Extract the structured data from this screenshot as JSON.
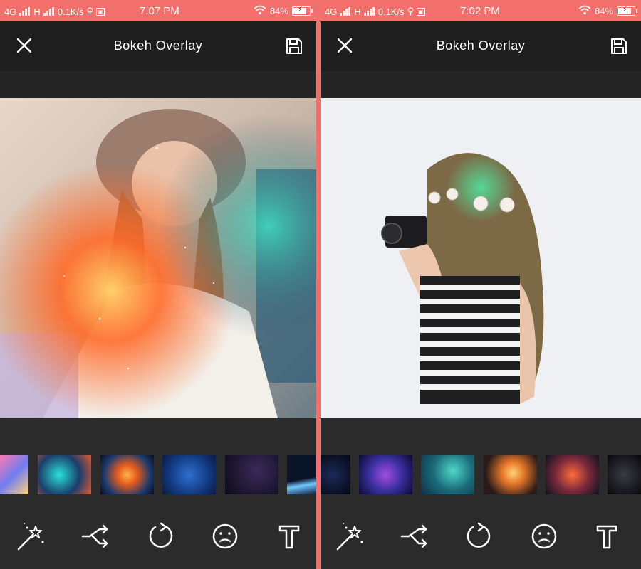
{
  "screens": [
    {
      "status": {
        "network": "4G",
        "network2": "H",
        "speed": "0.1K/s",
        "time": "7:07 PM",
        "battery": "84%",
        "battery_level": 0.84
      },
      "app_bar": {
        "title": "Bokeh Overlay"
      },
      "thumbnails": [
        "pink-nebula",
        "teal-orange-nebula",
        "orange-blue-nebula",
        "blue-starfield",
        "dark-starfield",
        "planet-horizon"
      ],
      "tools": [
        "magic-wand-icon",
        "shuffle-icon",
        "rotate-icon",
        "confused-face-icon",
        "text-icon"
      ]
    },
    {
      "status": {
        "network": "4G",
        "network2": "H",
        "speed": "0.1K/s",
        "time": "7:02 PM",
        "battery": "84%",
        "battery_level": 0.84
      },
      "app_bar": {
        "title": "Bokeh Overlay"
      },
      "thumbnails": [
        "dark-blue-space",
        "purple-nebula",
        "teal-nebula",
        "orange-flare-nebula",
        "red-nebula",
        "dark-stars"
      ],
      "tools": [
        "magic-wand-icon",
        "shuffle-icon",
        "rotate-icon",
        "confused-face-icon",
        "text-icon"
      ]
    }
  ],
  "colors": {
    "accent": "#f36f6b",
    "app_bar": "#1e1e1e",
    "background": "#2b2b2b"
  }
}
